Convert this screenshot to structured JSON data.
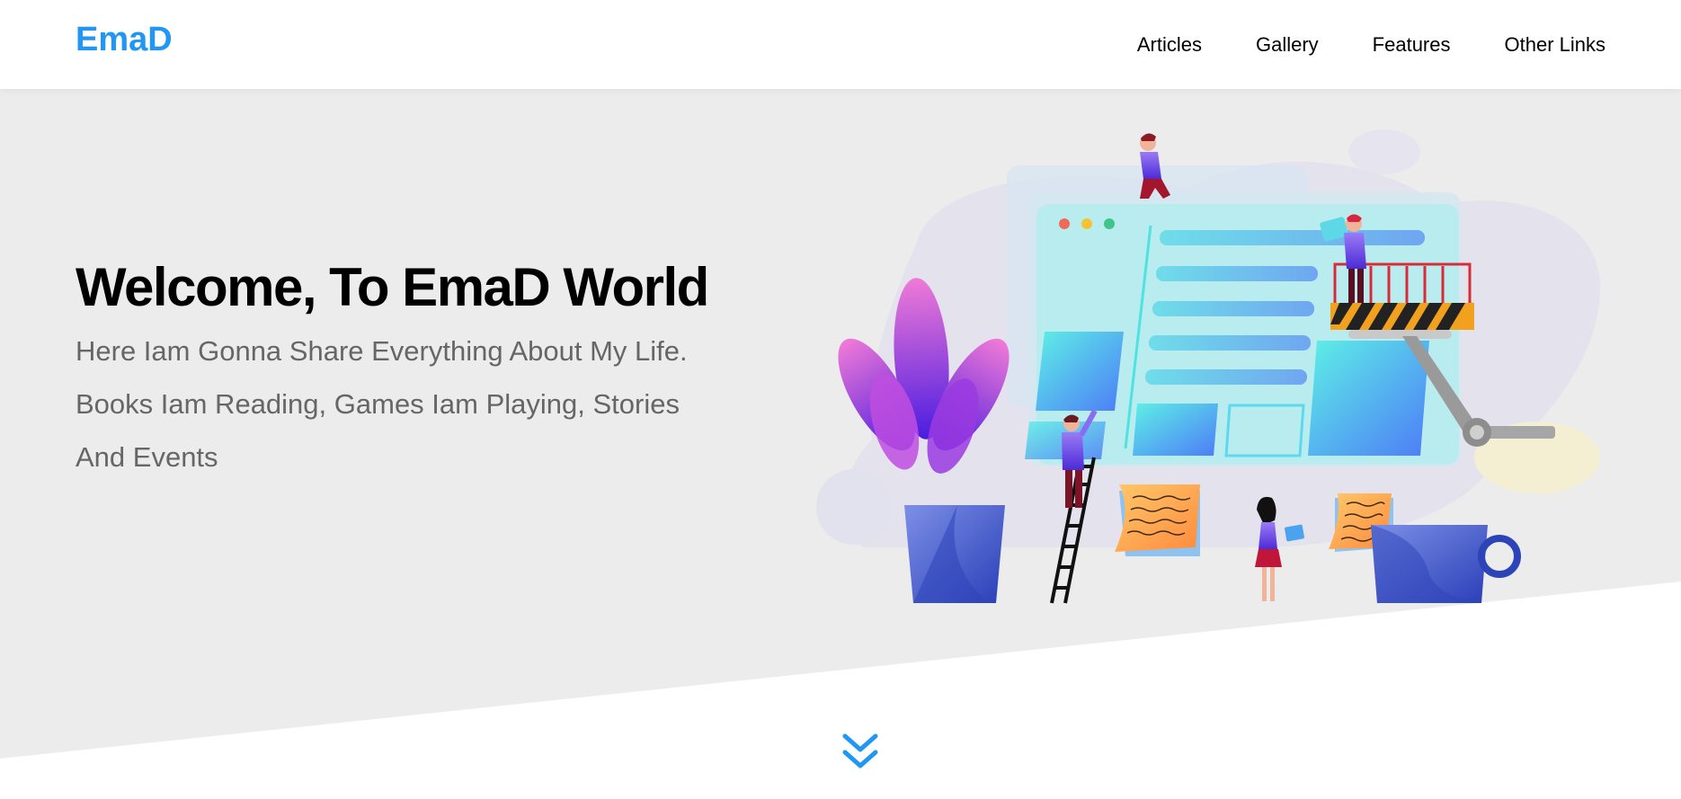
{
  "header": {
    "logo": "EmaD",
    "nav": [
      "Articles",
      "Gallery",
      "Features",
      "Other Links"
    ]
  },
  "landing": {
    "title": "Welcome, To EmaD World",
    "description": "Here Iam Gonna Share Everything About My Life. Books Iam Reading, Games Iam Playing, Stories And Events"
  },
  "colors": {
    "accent": "#2196f3",
    "landing_bg": "#ececec",
    "text_dark": "#000000",
    "text_muted": "#666666"
  },
  "icons": {
    "go_down": "angles-down-icon"
  }
}
